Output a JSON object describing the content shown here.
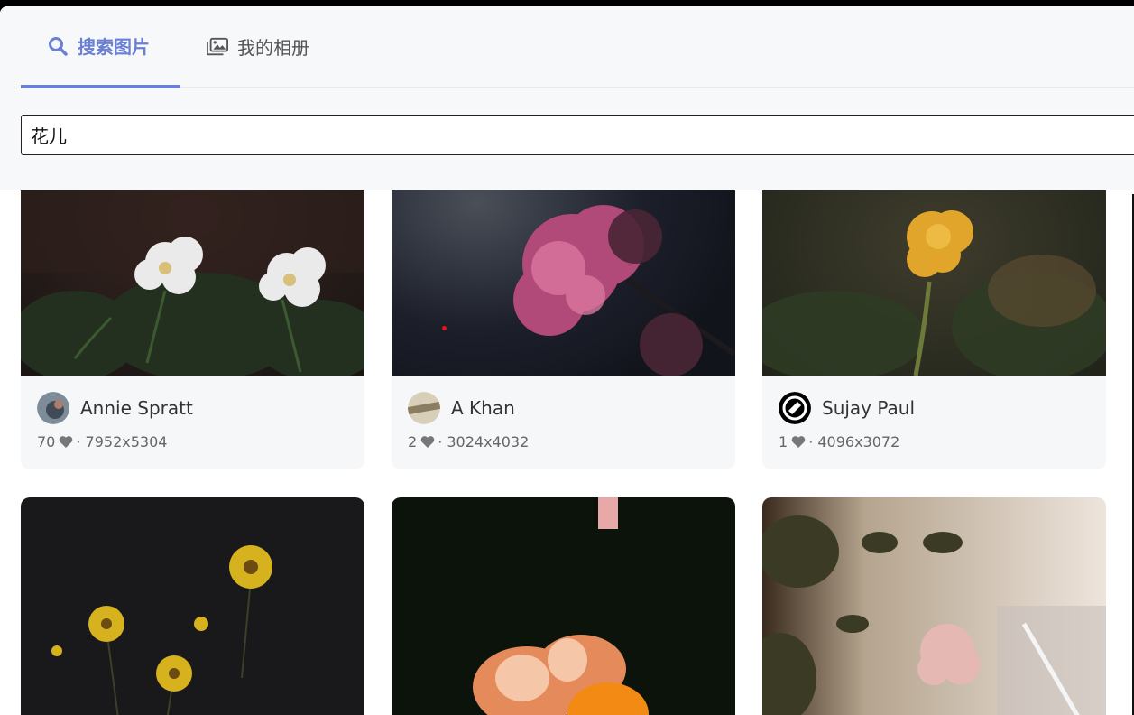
{
  "tabs": {
    "search_label": "搜索图片",
    "album_label": "我的相册"
  },
  "search": {
    "value": "花儿"
  },
  "results": [
    {
      "author": "Annie Spratt",
      "likes": "70",
      "dimensions": "7952x5304"
    },
    {
      "author": "A Khan",
      "likes": "2",
      "dimensions": "3024x4032"
    },
    {
      "author": "Sujay Paul",
      "likes": "1",
      "dimensions": "4096x3072"
    }
  ],
  "colors": {
    "accent": "#6a7fd6",
    "header_bg": "#f7f8fa",
    "card_bg": "#f6f7f9"
  },
  "icons": {
    "search_tab": "search-icon",
    "album_tab": "images-icon",
    "like": "heart-icon"
  }
}
